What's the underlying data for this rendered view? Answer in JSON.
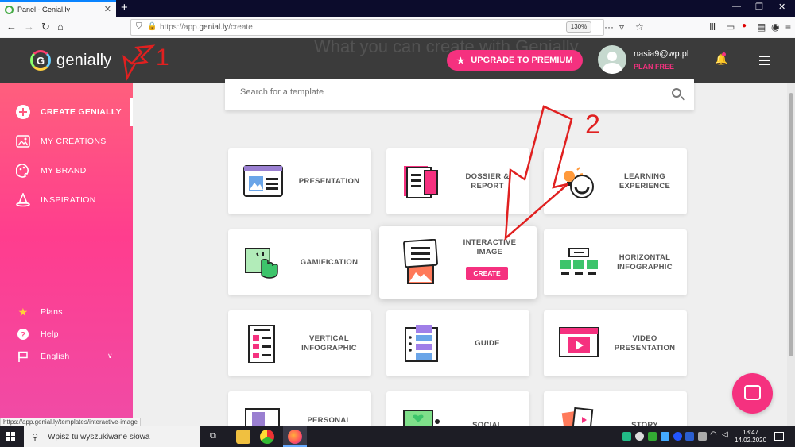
{
  "browser": {
    "tab_title": "Panel - Genial.ly",
    "tab_close": "✕",
    "new_tab": "+",
    "url_prefix": "https://app.",
    "url_main": "genial.ly",
    "url_path": "/create",
    "zoom": "130%",
    "window_controls": [
      "—",
      "❐",
      "✕"
    ],
    "status_url": "https://app.genial.ly/templates/interactive-image"
  },
  "header": {
    "logo_text": "genially",
    "background_title": "What you can create with Genially",
    "upgrade_label": "UPGRADE TO PREMIUM",
    "user_email": "nasia9@wp.pl",
    "user_plan": "PLAN FREE"
  },
  "sidebar": {
    "items": [
      {
        "label": "CREATE GENIALLY",
        "icon": "plus-circle-icon"
      },
      {
        "label": "MY CREATIONS",
        "icon": "image-icon"
      },
      {
        "label": "MY BRAND",
        "icon": "palette-icon"
      },
      {
        "label": "INSPIRATION",
        "icon": "wizard-hat-icon"
      }
    ],
    "bottom": [
      {
        "label": "Plans",
        "icon": "star-icon"
      },
      {
        "label": "Help",
        "icon": "question-icon"
      },
      {
        "label": "English",
        "icon": "flag-icon"
      }
    ]
  },
  "search": {
    "placeholder": "Search for a template"
  },
  "cards": [
    {
      "label_1": "PRESENTATION",
      "label_2": ""
    },
    {
      "label_1": "DOSSIER &",
      "label_2": "REPORT"
    },
    {
      "label_1": "LEARNING",
      "label_2": "EXPERIENCE"
    },
    {
      "label_1": "GAMIFICATION",
      "label_2": ""
    },
    {
      "label_1": "INTERACTIVE",
      "label_2": "IMAGE",
      "button": "CREATE"
    },
    {
      "label_1": "HORIZONTAL",
      "label_2": "INFOGRAPHIC"
    },
    {
      "label_1": "VERTICAL",
      "label_2": "INFOGRAPHIC"
    },
    {
      "label_1": "GUIDE",
      "label_2": ""
    },
    {
      "label_1": "VIDEO",
      "label_2": "PRESENTATION"
    },
    {
      "label_1": "PERSONAL",
      "label_2": ""
    },
    {
      "label_1": "SOCIAL",
      "label_2": ""
    },
    {
      "label_1": "STORY",
      "label_2": ""
    }
  ],
  "annotations": {
    "label_1": "1",
    "label_2": "2",
    "color": "#e02020"
  },
  "taskbar": {
    "search_text": "Wpisz tu wyszukiwane słowa",
    "time": "18:47",
    "date": "14.02.2020"
  },
  "colors": {
    "accent": "#f5317f",
    "header_bg": "#3b3b3b",
    "sidebar_top": "#ff5f7d",
    "sidebar_bottom": "#f04ba6"
  }
}
